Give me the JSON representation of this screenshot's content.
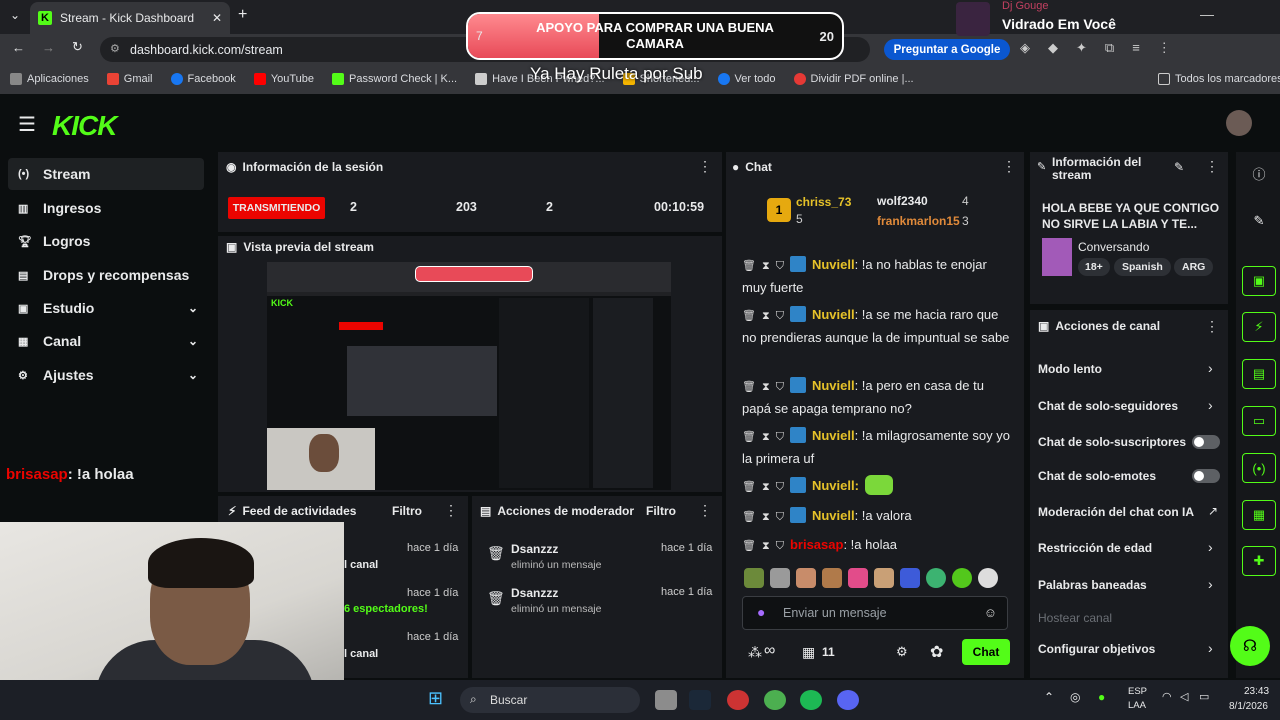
{
  "browser": {
    "tab_title": "Stream - Kick Dashboard",
    "url": "dashboard.kick.com/stream",
    "ask_google": "Preguntar a Google",
    "bookmarks": [
      "Aplicaciones",
      "Gmail",
      "Facebook",
      "YouTube",
      "Password Check | K...",
      "Have I Been Pwned?...",
      "Shortened...",
      "Ver todo",
      "Dividir PDF online |..."
    ],
    "all_bookmarks": "Todos los marcadores"
  },
  "overlay": {
    "goal_text": "APOYO PARA COMPRAR UNA BUENA CAMARA",
    "goal_current": "7",
    "goal_target": "20",
    "goal_progress": 0.35,
    "ruleta": "Ya Hay Ruleta por Sub",
    "music_artist": "Dj Gouge",
    "music_title": "Vidrado Em Você"
  },
  "sidebar": {
    "items": [
      {
        "label": "Stream"
      },
      {
        "label": "Ingresos"
      },
      {
        "label": "Logros"
      },
      {
        "label": "Drops y recompensas"
      },
      {
        "label": "Estudio"
      },
      {
        "label": "Canal"
      },
      {
        "label": "Ajustes"
      }
    ]
  },
  "session": {
    "title": "Información de la sesión",
    "live": "TRANSMITIENDO",
    "stat1": "2",
    "stat2": "203",
    "stat3": "2",
    "time": "00:10:59"
  },
  "preview": {
    "title": "Vista previa del stream",
    "chat_user": "brisasap",
    "chat_text": ": !a holaa"
  },
  "feed": {
    "title": "Feed de actividades",
    "filter": "Filtro",
    "items": [
      {
        "time": "hace 1 día",
        "text": "l canal"
      },
      {
        "time": "hace 1 día",
        "text": "6 espectadores!"
      },
      {
        "time": "hace 1 día",
        "text": "l canal"
      }
    ]
  },
  "modactions": {
    "title": "Acciones de moderador",
    "filter": "Filtro",
    "items": [
      {
        "user": "Dsanzzz",
        "action": "eliminó un mensaje",
        "time": "hace 1 día"
      },
      {
        "user": "Dsanzzz",
        "action": "eliminó un mensaje",
        "time": "hace 1 día"
      }
    ]
  },
  "chat": {
    "title": "Chat",
    "top": [
      {
        "name": "chriss_73",
        "count": "5"
      },
      {
        "name": "wolf2340",
        "count": "4"
      },
      {
        "name": "frankmarlon15",
        "count": "3"
      }
    ],
    "messages": [
      {
        "user": "Nuviell",
        "text": ": !a no hablas te enojar muy fuerte"
      },
      {
        "user": "Nuviell",
        "text": ": !a se me hacia raro que no prendieras aunque la de impuntual se sabe"
      },
      {
        "user": "Nuviell",
        "text": ": !a pero en casa de tu papá se apaga temprano no?"
      },
      {
        "user": "Nuviell",
        "text": ": !a milagrosamente soy yo la primera uf"
      },
      {
        "user": "Nuviell",
        "text": ":"
      },
      {
        "user": "Nuviell",
        "text": ": !a valora"
      },
      {
        "user": "brisasap",
        "text": ": !a holaa"
      }
    ],
    "placeholder": "Enviar un mensaje",
    "infinity": "∞",
    "gifts": "11",
    "send": "Chat"
  },
  "streaminfo": {
    "title": "Información del stream",
    "stream_title": "HOLA BEBE YA QUE CONTIGO NO SIRVE LA LABIA Y TE...",
    "category": "Conversando",
    "tags": [
      "18+",
      "Spanish",
      "ARG"
    ]
  },
  "channel_actions": {
    "title": "Acciones de canal",
    "items": [
      "Modo lento",
      "Chat de solo-seguidores",
      "Chat de solo-suscriptores",
      "Chat de solo-emotes",
      "Moderación del chat con IA",
      "Restricción de edad",
      "Palabras baneadas",
      "Hostear canal",
      "Configurar objetivos"
    ]
  },
  "taskbar": {
    "search": "Buscar",
    "lang1": "ESP",
    "lang2": "LAA",
    "time": "23:43",
    "date": "8/1/2026"
  },
  "colors": {
    "kick_green": "#53fc18",
    "live_red": "#eb0400",
    "username_gold": "#e6c229"
  }
}
